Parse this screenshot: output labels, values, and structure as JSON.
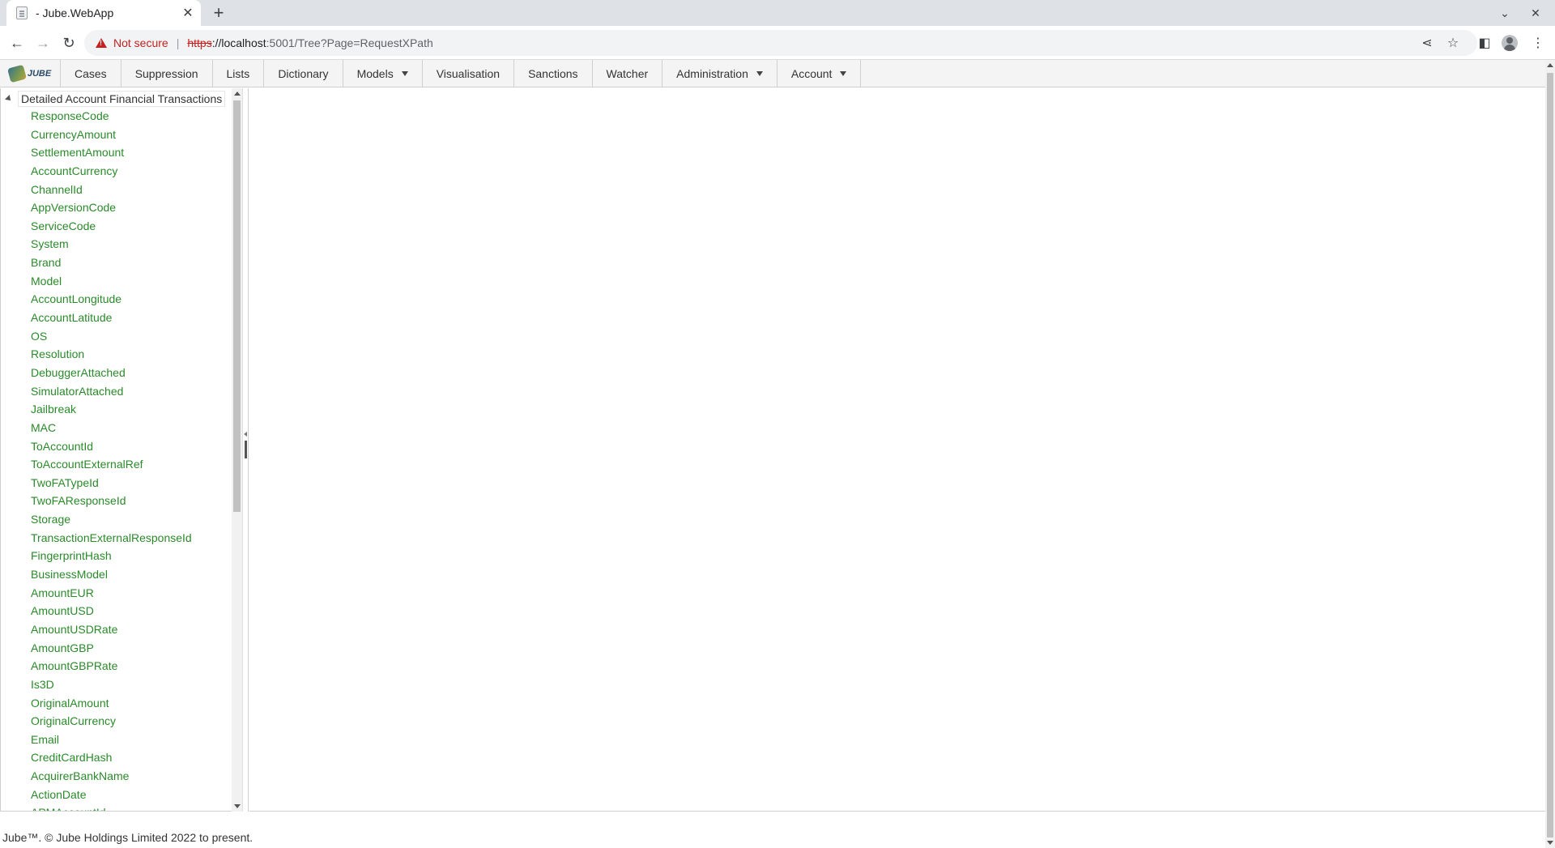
{
  "browser": {
    "tab_title": " - Jube.WebApp",
    "new_tab_icon": "plus-icon",
    "url_scheme": "https",
    "url_host": "://localhost",
    "url_rest": ":5001/Tree?Page=RequestXPath",
    "not_secure": "Not secure",
    "separator": "|"
  },
  "app": {
    "logo_text": "JUBE",
    "menu": [
      {
        "label": "Cases",
        "dropdown": false
      },
      {
        "label": "Suppression",
        "dropdown": false
      },
      {
        "label": "Lists",
        "dropdown": false
      },
      {
        "label": "Dictionary",
        "dropdown": false
      },
      {
        "label": "Models",
        "dropdown": true
      },
      {
        "label": "Visualisation",
        "dropdown": false
      },
      {
        "label": "Sanctions",
        "dropdown": false
      },
      {
        "label": "Watcher",
        "dropdown": false
      },
      {
        "label": "Administration",
        "dropdown": true
      },
      {
        "label": "Account",
        "dropdown": true
      }
    ],
    "tree": {
      "root_label": "Detailed Account Financial Transactions",
      "items": [
        "ResponseCode",
        "CurrencyAmount",
        "SettlementAmount",
        "AccountCurrency",
        "ChannelId",
        "AppVersionCode",
        "ServiceCode",
        "System",
        "Brand",
        "Model",
        "AccountLongitude",
        "AccountLatitude",
        "OS",
        "Resolution",
        "DebuggerAttached",
        "SimulatorAttached",
        "Jailbreak",
        "MAC",
        "ToAccountId",
        "ToAccountExternalRef",
        "TwoFATypeId",
        "TwoFAResponseId",
        "Storage",
        "TransactionExternalResponseId",
        "FingerprintHash",
        "BusinessModel",
        "AmountEUR",
        "AmountUSD",
        "AmountUSDRate",
        "AmountGBP",
        "AmountGBPRate",
        "Is3D",
        "OriginalAmount",
        "OriginalCurrency",
        "Email",
        "CreditCardHash",
        "AcquirerBankName",
        "ActionDate",
        "APMAccountId"
      ]
    },
    "footer": "Jube™. © Jube Holdings Limited 2022 to present."
  },
  "colors": {
    "tree_item": "#2a8a2a",
    "not_secure": "#c5221f"
  }
}
